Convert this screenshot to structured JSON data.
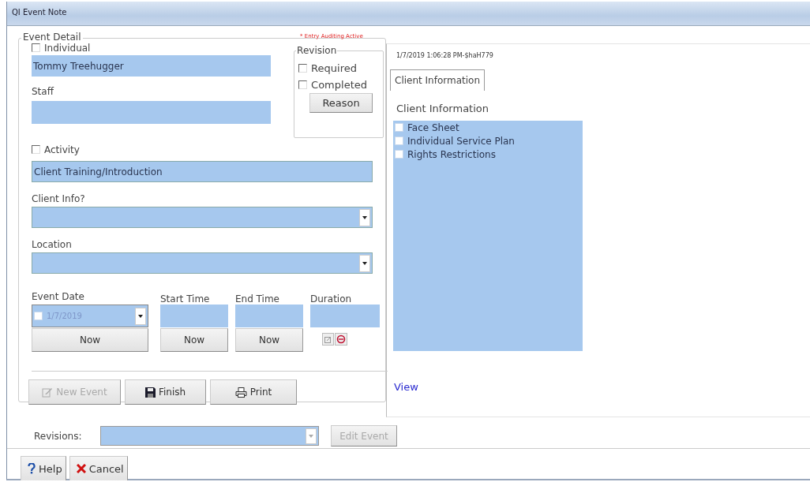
{
  "window": {
    "title": "QI Event Note"
  },
  "event_detail": {
    "legend": "Event Detail",
    "audit_note": "* Entry Auditing Active",
    "individual": {
      "label": "Individual",
      "checked": false,
      "value": "Tommy Treehugger"
    },
    "staff": {
      "label": "Staff"
    },
    "revision": {
      "legend": "Revision",
      "options": [
        {
          "label": "Required",
          "checked": false
        },
        {
          "label": "Completed",
          "checked": false
        }
      ],
      "reason_button": "Reason"
    },
    "activity": {
      "label": "Activity",
      "checked": false,
      "value": "Client Training/Introduction"
    },
    "client_info": {
      "label": "Client Info?"
    },
    "location": {
      "label": "Location"
    },
    "times": [
      {
        "kind": "date",
        "label": "Event Date",
        "value": "1/7/2019",
        "checked": false,
        "disabled": true,
        "button": "Now"
      },
      {
        "kind": "time",
        "label": "Start Time",
        "button": "Now"
      },
      {
        "kind": "time",
        "label": "End Time",
        "button": "Now"
      },
      {
        "kind": "duration",
        "label": "Duration"
      }
    ],
    "actions": [
      {
        "label": "New Event",
        "kind": "edit",
        "disabled": true
      },
      {
        "label": "Finish",
        "kind": "save",
        "disabled": false
      },
      {
        "label": "Print",
        "kind": "print",
        "disabled": false
      }
    ]
  },
  "client_panel": {
    "timestamp": "1/7/2019 1:06:28 PM-$haH779",
    "tabs": [
      {
        "label": "Client Information",
        "selected": true
      }
    ],
    "heading": "Client Information",
    "items": [
      {
        "label": "Face Sheet",
        "checked": false
      },
      {
        "label": "Individual Service Plan",
        "checked": false
      },
      {
        "label": "Rights Restrictions",
        "checked": false
      }
    ],
    "link": "View"
  },
  "revisions": {
    "label": "Revisions:",
    "edit_button": {
      "label": "Edit Event",
      "disabled": true
    }
  },
  "buttons": [
    {
      "label": "Help",
      "kind": "help"
    },
    {
      "label": "Cancel",
      "kind": "cancel"
    }
  ]
}
